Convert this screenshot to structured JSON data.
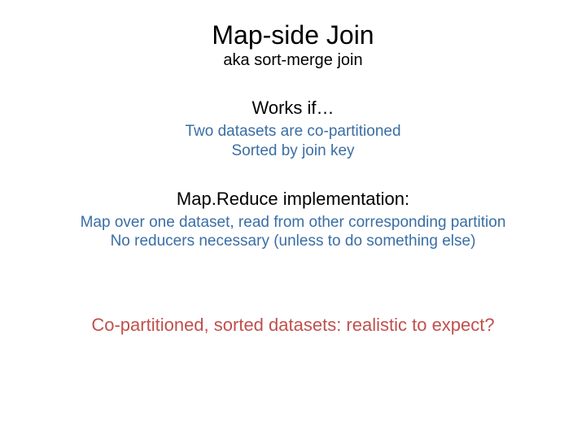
{
  "title": "Map-side Join",
  "subtitle": "aka sort-merge join",
  "section1": {
    "heading": "Works if…",
    "line1": "Two datasets are co-partitioned",
    "line2": "Sorted by join key"
  },
  "section2": {
    "heading": "Map.Reduce implementation:",
    "line1": "Map over one dataset, read from other corresponding partition",
    "line2": "No reducers necessary (unless to do something else)"
  },
  "question": "Co-partitioned, sorted datasets: realistic to expect?"
}
